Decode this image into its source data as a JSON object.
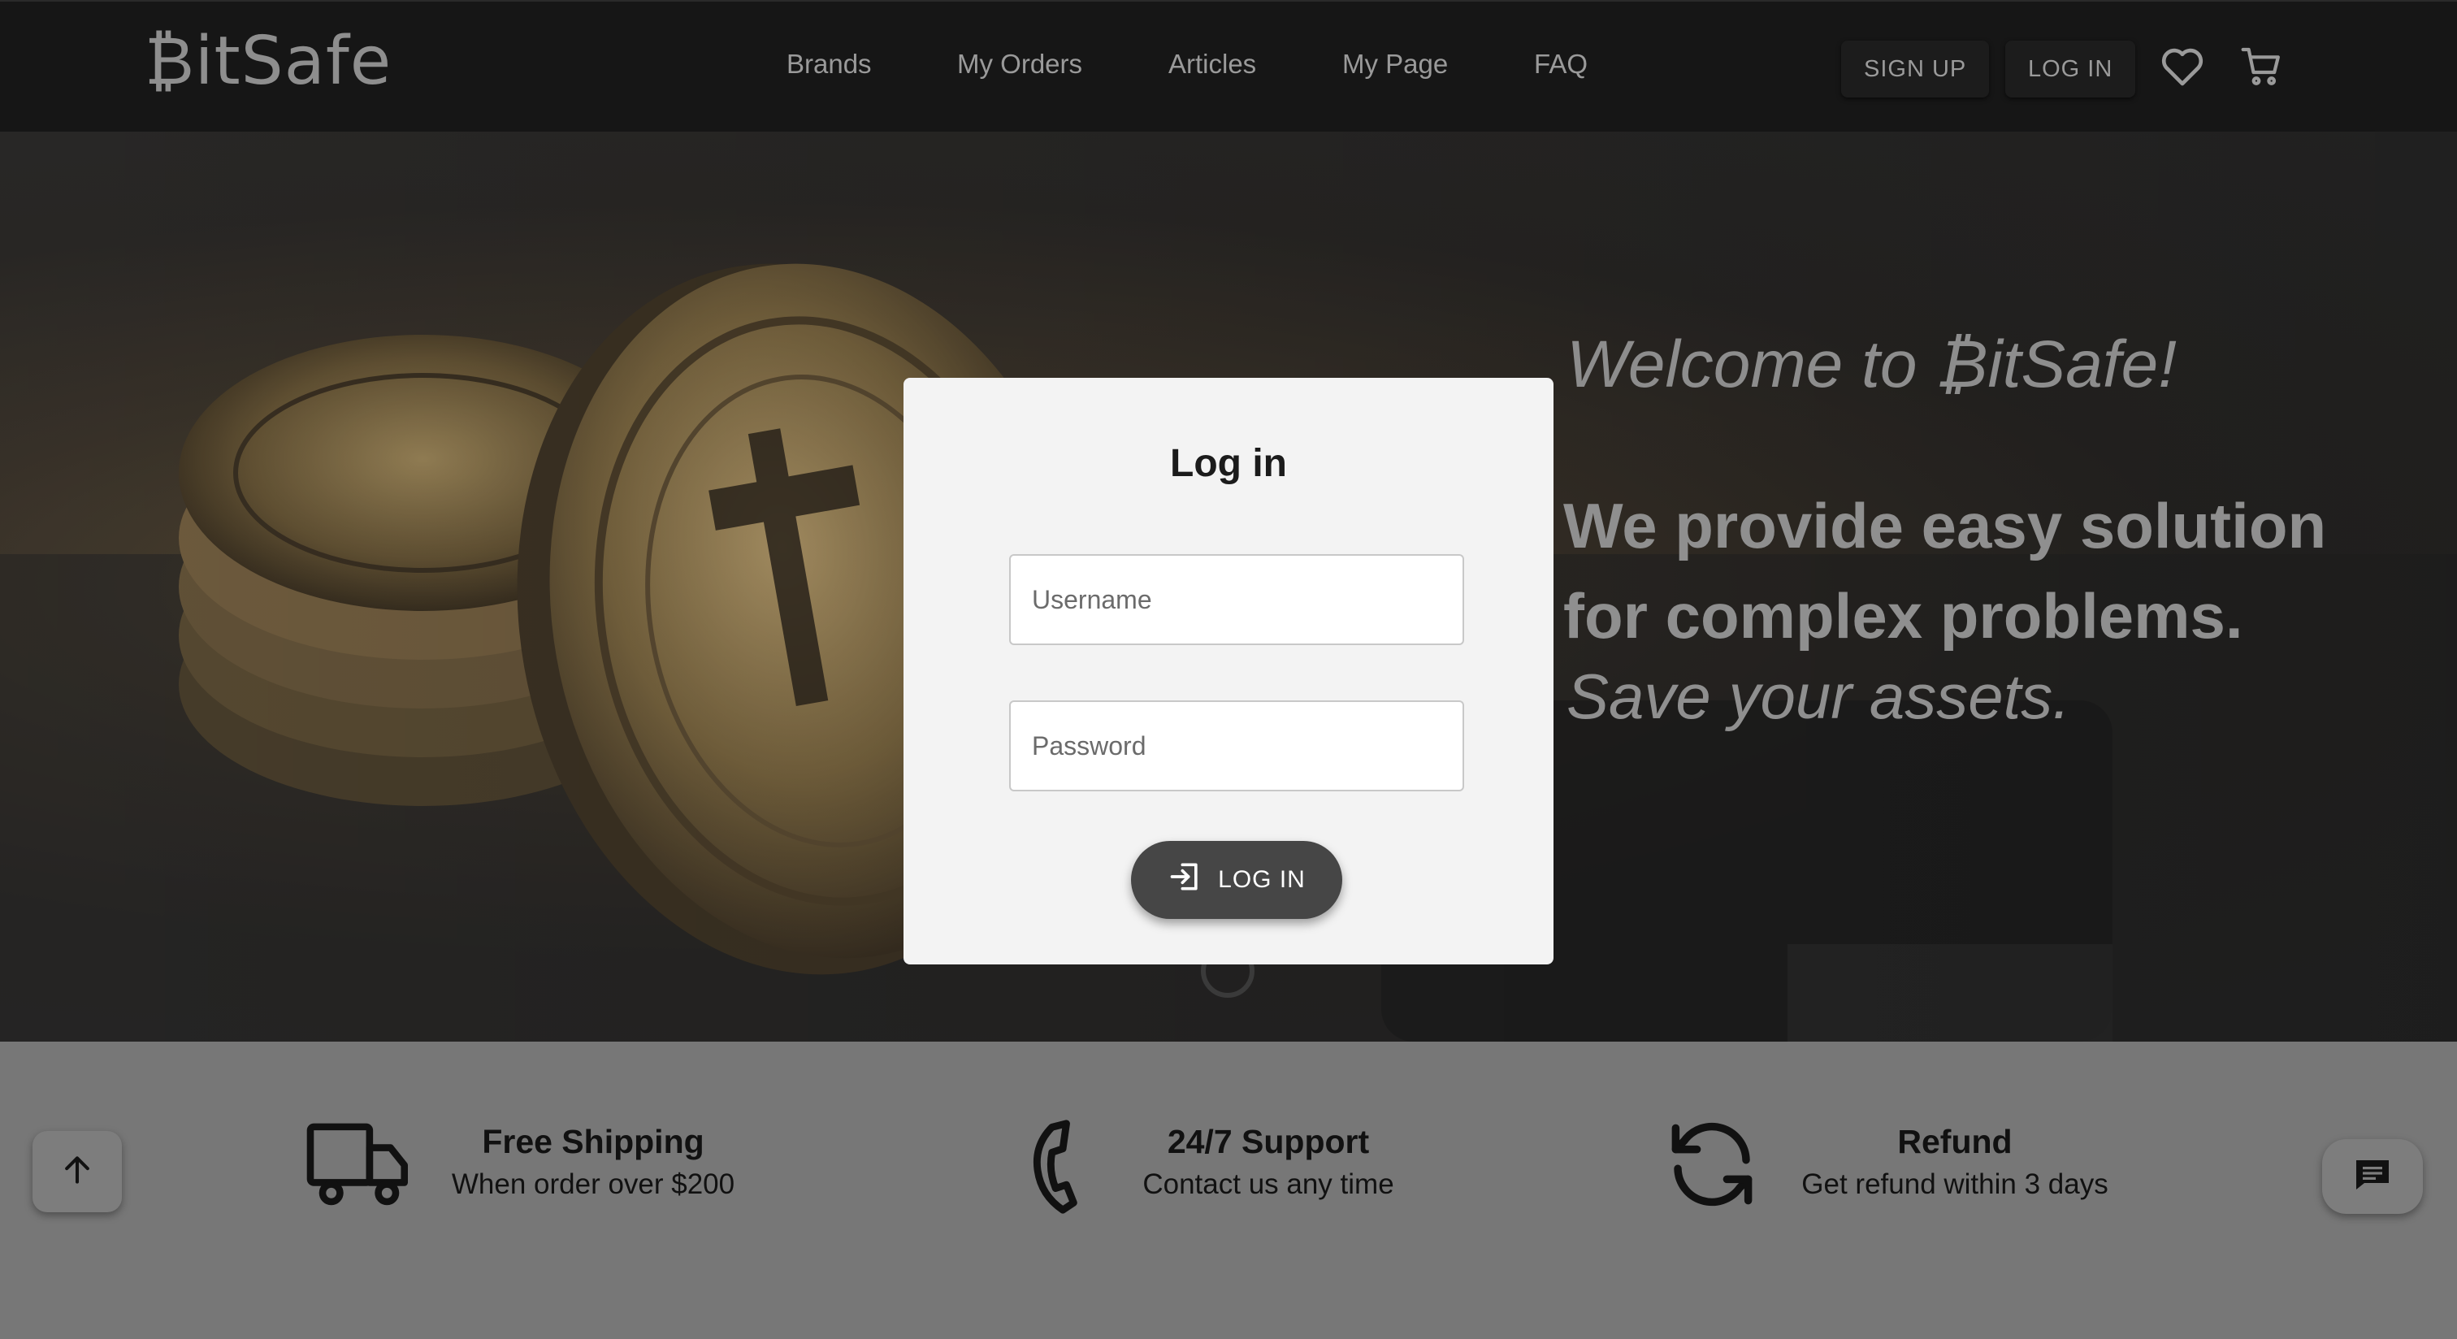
{
  "header": {
    "logo": "₿itSafe",
    "nav": [
      "Brands",
      "My Orders",
      "Articles",
      "My Page",
      "FAQ"
    ],
    "signup_label": "SIGN UP",
    "login_label": "LOG IN"
  },
  "hero": {
    "welcome": "Welcome to ₿itSafe!",
    "tagline_line1": "We provide easy solution",
    "tagline_line2": "for complex problems.",
    "subline": "Save your assets."
  },
  "login_card": {
    "title": "Log in",
    "username_placeholder": "Username",
    "password_placeholder": "Password",
    "submit_label": "LOG IN"
  },
  "features": [
    {
      "icon": "truck-icon",
      "title": "Free Shipping",
      "subtitle": "When order over $200"
    },
    {
      "icon": "phone-icon",
      "title": "24/7 Support",
      "subtitle": "Contact us any time"
    },
    {
      "icon": "refresh-icon",
      "title": "Refund",
      "subtitle": "Get refund within 3 days"
    }
  ],
  "icons": {
    "wishlist": "heart-icon",
    "cart": "cart-icon",
    "scroll_top": "arrow-up-icon",
    "chat": "chat-icon"
  }
}
